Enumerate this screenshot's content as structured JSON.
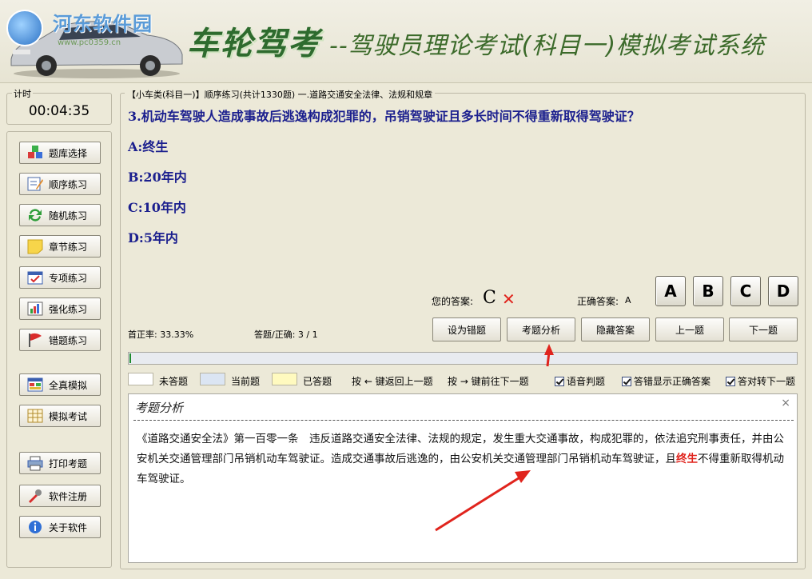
{
  "header": {
    "site_name": "河东软件园",
    "site_url": "www.pc0359.cn",
    "brand": "车轮驾考",
    "subtitle": "--驾驶员理论考试(科目一)模拟考试系统"
  },
  "timer": {
    "label": "计时",
    "value": "00:04:35"
  },
  "nav": [
    {
      "label": "题库选择",
      "icon": "question-bank-icon"
    },
    {
      "label": "顺序练习",
      "icon": "pencil-note-icon"
    },
    {
      "label": "随机练习",
      "icon": "refresh-arrows-icon"
    },
    {
      "label": "章节练习",
      "icon": "sticky-note-icon"
    },
    {
      "label": "专项练习",
      "icon": "checkbox-calendar-icon"
    },
    {
      "label": "强化练习",
      "icon": "bar-chart-icon"
    },
    {
      "label": "错题练习",
      "icon": "red-flag-icon"
    },
    {
      "label": "全真模拟",
      "icon": "window-grid-icon"
    },
    {
      "label": "模拟考试",
      "icon": "calendar-grid-icon"
    },
    {
      "label": "打印考题",
      "icon": "printer-icon"
    },
    {
      "label": "软件注册",
      "icon": "wrench-icon"
    },
    {
      "label": "关于软件",
      "icon": "info-icon"
    }
  ],
  "question": {
    "breadcrumb": "【小车类(科目一)】顺序练习(共计1330题) 一.道路交通安全法律、法规和规章",
    "text": "3.机动车驾驶人造成事故后逃逸构成犯罪的，吊销驾驶证且多长时间不得重新取得驾驶证？",
    "options": [
      "A:终生",
      "B:20年内",
      "C:10年内",
      "D:5年内"
    ]
  },
  "answer": {
    "your_label": "您的答案:",
    "your_value": "C",
    "wrong_mark": "✕",
    "correct_label": "正确答案:",
    "correct_value": "A"
  },
  "option_buttons": [
    "A",
    "B",
    "C",
    "D"
  ],
  "stats": {
    "accuracy": "首正率: 33.33%",
    "answered": "答题/正确: 3 / 1"
  },
  "actions": [
    "设为错题",
    "考题分析",
    "隐藏答案",
    "上一题",
    "下一题"
  ],
  "progress": {
    "fraction": 0.0023
  },
  "legend": [
    {
      "label": "未答题",
      "color": "#ffffff"
    },
    {
      "label": "当前题",
      "color": "#dbe5f3"
    },
    {
      "label": "已答题",
      "color": "#fffabf"
    }
  ],
  "hints": [
    "按 ← 键返回上一题",
    "按 → 键前往下一题"
  ],
  "options_checks": [
    "语音判题",
    "答错显示正确答案",
    "答对转下一题"
  ],
  "analysis": {
    "title": "考题分析",
    "close": "×",
    "body_part1": "《道路交通安全法》第一百零一条　违反道路交通安全法律、法规的规定，发生重大交通事故，构成犯罪的，依法追究刑事责任，并由公安机关交通管理部门吊销机动车驾驶证。造成交通事故后逃逸的，由公安机关交通管理部门吊销机动车驾驶证，且",
    "highlight": "终生",
    "body_part2": "不得重新取得机动车驾驶证。"
  },
  "colors": {
    "accent": "#1b1f8e",
    "highlight": "#e0241d",
    "progress": "#1e8b2e"
  }
}
